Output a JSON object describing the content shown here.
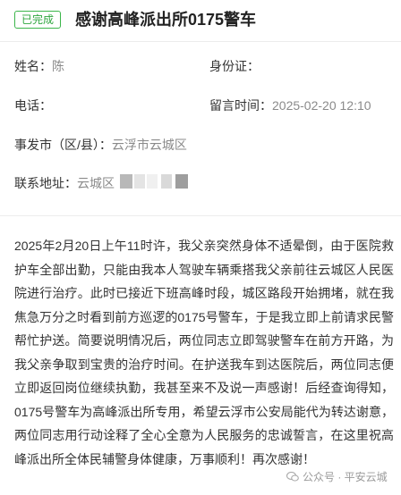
{
  "header": {
    "status_badge": "已完成",
    "title": "感谢高峰派出所0175警车"
  },
  "fields": {
    "name_label": "姓名：",
    "name_value": "陈",
    "id_label": "身份证：",
    "id_value": "",
    "phone_label": "电话：",
    "phone_value": "",
    "time_label": "留言时间：",
    "time_value": "2025-02-20 12:10",
    "city_label": "事发市（区/县）：",
    "city_value": "云浮市云城区",
    "address_label": "联系地址：",
    "address_value": "云城区"
  },
  "content": {
    "text": "2025年2月20日上午11时许，我父亲突然身体不适晕倒，由于医院救护车全部出勤，只能由我本人驾驶车辆乘搭我父亲前往云城区人民医院进行治疗。此时已接近下班高峰时段，城区路段开始拥堵，就在我焦急万分之时看到前方巡逻的0175号警车，于是我立即上前请求民警帮忙护送。简要说明情况后，两位同志立即驾驶警车在前方开路，为我父亲争取到宝贵的治疗时间。在护送我车到达医院后，两位同志便立即返回岗位继续执勤，我甚至来不及说一声感谢！后经查询得知，0175号警车为高峰派出所专用，希望云浮市公安局能代为转达谢意，两位同志用行动诠释了全心全意为人民服务的忠诚誓言，在这里祝高峰派出所全体民辅警身体健康，万事顺利！再次感谢！"
  },
  "watermark": {
    "text": "公众号 · 平安云城",
    "icon": "wechat-icon"
  },
  "colors": {
    "badge_green": "#3bb54a",
    "label": "#333333",
    "value_gray": "#8a8a8a"
  }
}
